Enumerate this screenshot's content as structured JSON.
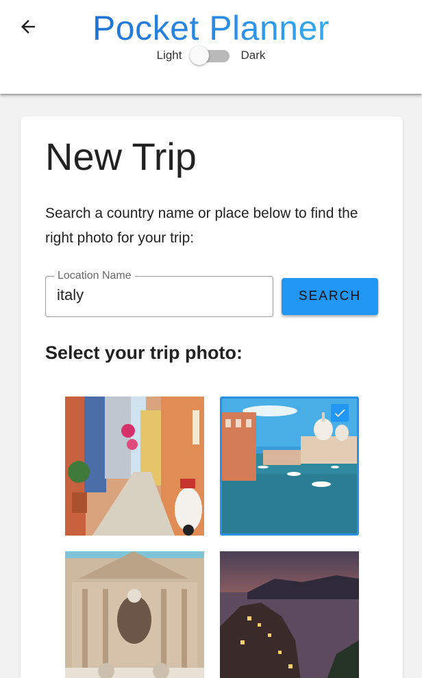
{
  "header": {
    "title": "Pocket Planner",
    "back_icon": "arrow-back-icon",
    "theme": {
      "light_label": "Light",
      "dark_label": "Dark",
      "dark_mode": false
    }
  },
  "colors": {
    "accent": "#2196f3",
    "title_gradient_start": "#1a5fc7",
    "title_gradient_end": "#3fc4f4",
    "background": "#f2f2f2"
  },
  "form": {
    "heading": "New Trip",
    "intro": "Search a country name or place below to find the right photo for your trip:",
    "location_field": {
      "label": "Location Name",
      "value": "italy"
    },
    "search_button": "SEARCH",
    "photos_heading": "Select your trip photo:"
  },
  "photos": [
    {
      "subject": "narrow colorful alley with scooter",
      "selected": false
    },
    {
      "subject": "venice grand canal",
      "selected": true
    },
    {
      "subject": "trevi fountain baroque facade",
      "selected": false
    },
    {
      "subject": "cliffside village at sunset",
      "selected": false
    }
  ]
}
